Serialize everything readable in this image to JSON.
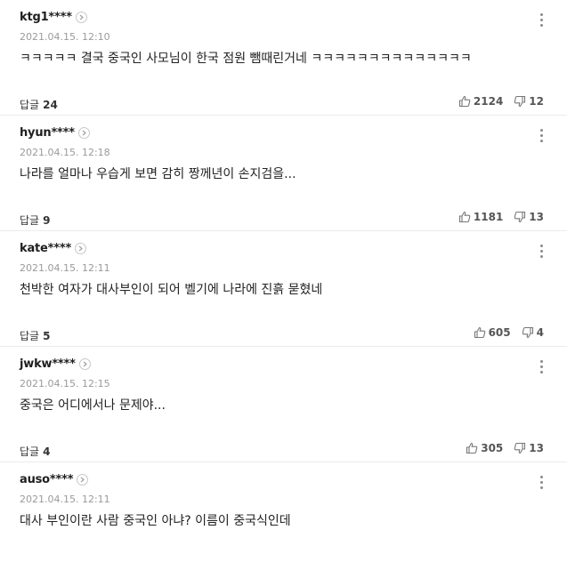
{
  "labels": {
    "reply": "답글"
  },
  "comments": [
    {
      "user": "ktg1****",
      "date": "2021.04.15. 12:10",
      "text": "ㅋㅋㅋㅋㅋ 결국 중국인 사모님이 한국 점원 뺌때린거네 ㅋㅋㅋㅋㅋㅋㅋㅋㅋㅋㅋㅋㅋㅋ",
      "replies": "24",
      "likes": "2124",
      "dislikes": "12"
    },
    {
      "user": "hyun****",
      "date": "2021.04.15. 12:18",
      "text": "나라를 얼마나 우습게 보면 감히 짱께년이 손지검을...",
      "replies": "9",
      "likes": "1181",
      "dislikes": "13"
    },
    {
      "user": "kate****",
      "date": "2021.04.15. 12:11",
      "text": "천박한 여자가 대사부인이 되어 벨기에 나라에 진흙 묻혔네",
      "replies": "5",
      "likes": "605",
      "dislikes": "4"
    },
    {
      "user": "jwkw****",
      "date": "2021.04.15. 12:15",
      "text": "중국은 어디에서나 문제야...",
      "replies": "4",
      "likes": "305",
      "dislikes": "13"
    },
    {
      "user": "auso****",
      "date": "2021.04.15. 12:11",
      "text": "대사 부인이란 사람 중국인 아냐? 이름이 중국식인데"
    }
  ]
}
